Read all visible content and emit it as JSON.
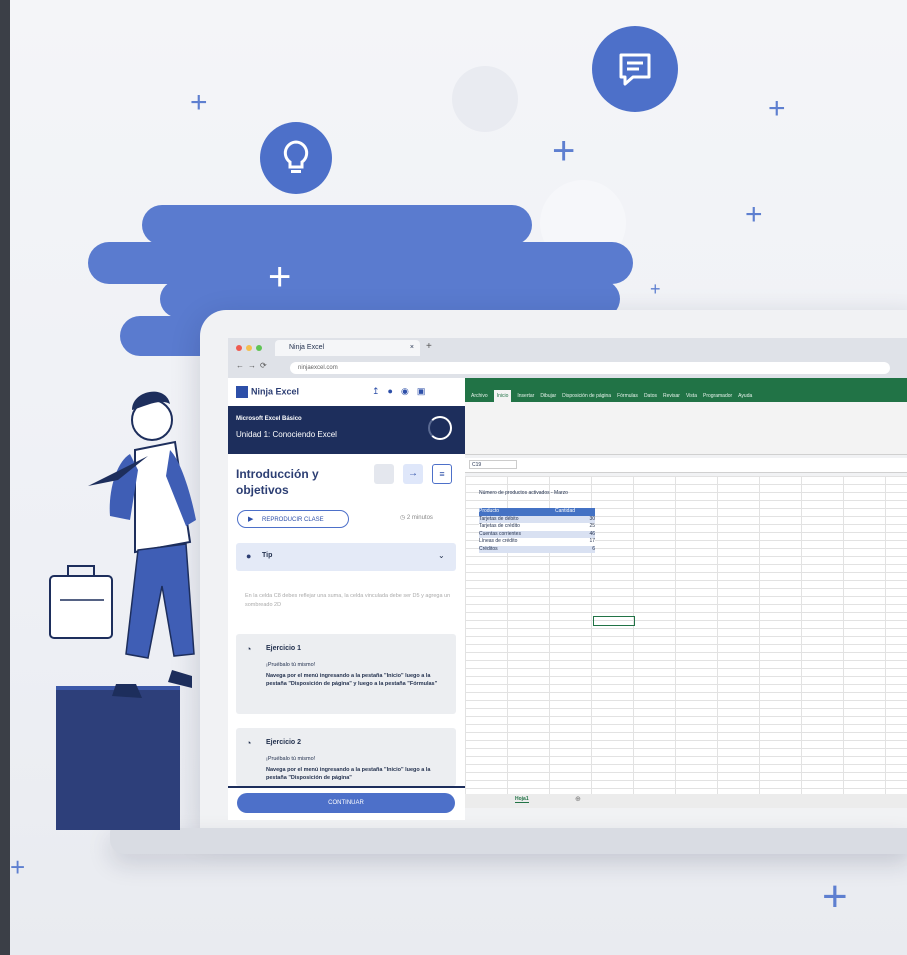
{
  "colors": {
    "accent": "#4d70c9",
    "navy": "#1d2e5c",
    "excel_green": "#217346"
  },
  "browser": {
    "tab_title": "Ninja Excel",
    "url": "ninjaexcel.com"
  },
  "ninja": {
    "logo_text": "Ninja Excel",
    "course": "Microsoft Excel Básico",
    "unit": "Unidad 1: Conociendo Excel",
    "lesson_title": "Introducción y objetivos",
    "play_label": "REPRODUCIR CLASE",
    "duration": "2 minutos",
    "tip_label": "Tip",
    "tip_text": "En la celda C8 debes reflejar una suma, la celda vinculada debe ser D5 y agrega un sombreado 2D",
    "exercises": [
      {
        "title": "Ejercicio 1",
        "subtitle": "¡Pruébalo tú mismo!",
        "text": "Navega por el menú ingresando a la pestaña \"Inicio\" luego a la pestaña \"Disposición de página\" y luego a la pestaña \"Fórmulas\""
      },
      {
        "title": "Ejercicio 2",
        "subtitle": "¡Pruébalo tú mismo!",
        "text": "Navega por el menú ingresando a la pestaña \"Inicio\" luego a la pestaña \"Disposición de página\""
      }
    ],
    "continue_label": "CONTINUAR"
  },
  "excel": {
    "ribbon_tabs": [
      "Archivo",
      "Inicio",
      "Insertar",
      "Dibujar",
      "Disposición de página",
      "Fórmulas",
      "Datos",
      "Revisar",
      "Vista",
      "Programador",
      "Ayuda"
    ],
    "name_box": "C19",
    "sheet_title": "Número de productos activados - Marzo",
    "table_headers": [
      "Producto",
      "Cantidad"
    ],
    "table_rows": [
      [
        "Tarjetas de débito",
        "30"
      ],
      [
        "Tarjetas de crédito",
        "25"
      ],
      [
        "Cuentas corrientes",
        "46"
      ],
      [
        "Líneas de crédito",
        "17"
      ],
      [
        "Créditos",
        "6"
      ]
    ],
    "sheet_tab": "Hoja1"
  }
}
